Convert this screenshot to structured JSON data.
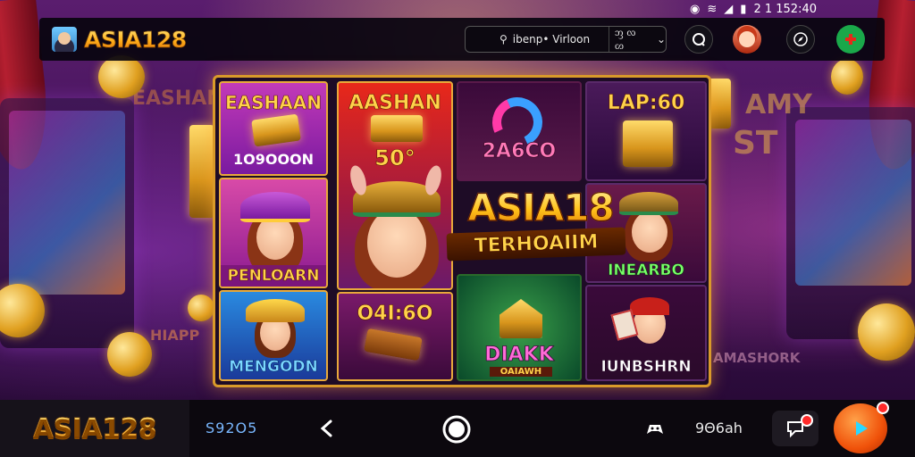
{
  "status_bar": {
    "time": "2 1 152:40"
  },
  "header": {
    "brand": "ASIA128",
    "search_placeholder": "ibenp• Virloon",
    "selector_value": "ᦀ ᦟ ᦠ",
    "icons": [
      "chat-icon",
      "profile-avatar",
      "compass-icon",
      "add-icon"
    ]
  },
  "tiles": [
    {
      "title": "EASHAAN",
      "caption": "1O9OOON"
    },
    {
      "title": "PENLOARN"
    },
    {
      "title": "MENGODN"
    },
    {
      "title": "AASHAN",
      "caption": "50°"
    },
    {
      "caption": "O4I:6O"
    },
    {
      "caption": "2A6CO"
    },
    {
      "title": "LAP:60"
    },
    {
      "title": "INEARBO"
    },
    {
      "title": "DIAKK",
      "caption": "OAIAWH"
    },
    {
      "title": "IUNBSHRN"
    }
  ],
  "promo": {
    "title": "ASIA18",
    "subtitle": "TERHOAIIM"
  },
  "bg_labels": {
    "left": "EASHAN",
    "right_top": "AMY",
    "right_mid": "ST",
    "right_bottom": "AMASHORK",
    "left_bottom": "HIAPP"
  },
  "bottom_bar": {
    "brand": "ASIA128",
    "code": "S92O5",
    "label": "9Θ6ah",
    "icons": [
      "back-icon",
      "home-circle-icon",
      "game-controller-icon",
      "chat-bubble-icon",
      "play-icon"
    ]
  },
  "colors": {
    "accent_gold": "#ffc21a",
    "accent_orange": "#f0520a",
    "add_green": "#1aa84a"
  }
}
